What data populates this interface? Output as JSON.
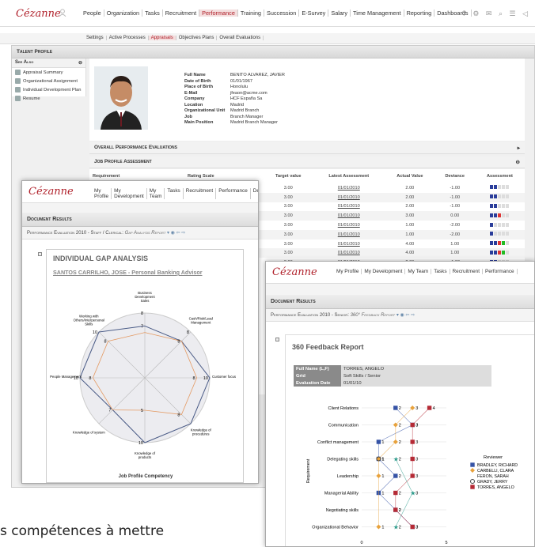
{
  "brand": "Cézanne",
  "main_nav": [
    "People",
    "Organization",
    "Tasks",
    "Recruitment",
    "Performance",
    "Training",
    "Succession",
    "E-Survey",
    "Salary",
    "Time Management",
    "Reporting",
    "Dashboards"
  ],
  "main_nav_active": "Performance",
  "sub_nav": [
    "Settings",
    "Active Processes",
    "Appraisals",
    "Objectives Plans",
    "Overall Evaluations"
  ],
  "sub_nav_active": "Appraisals",
  "talent_profile": "Talent Profile",
  "see_also": {
    "title": "See Also",
    "items": [
      "Appraisal Summary",
      "Organizational Assignment",
      "Individual Development Plan",
      "Resume"
    ]
  },
  "profile": [
    {
      "k": "Full Name",
      "v": "BENITO ALVAREZ, JAVIER"
    },
    {
      "k": "Date of Birth",
      "v": "01/01/1967"
    },
    {
      "k": "Place of Birth",
      "v": "Honolulu"
    },
    {
      "k": "E-Mail",
      "v": "jfeaon@acme.com"
    },
    {
      "k": "Company",
      "v": "HCF España Sa"
    },
    {
      "k": "Location",
      "v": "Madrid"
    },
    {
      "k": "Organizational Unit",
      "v": "Madrid Branch"
    },
    {
      "k": "Job",
      "v": "Branch Manager"
    },
    {
      "k": "Main Position",
      "v": "Madrid Branch Manager"
    }
  ],
  "overall_eval": "Overall Performance Evaluations",
  "job_profile": "Job Profile Assessment",
  "jp_headers": [
    "Requirement",
    "Rating Scale",
    "Target value",
    "Latest Assessment",
    "Actual Value",
    "Deviance",
    "Assessment"
  ],
  "jp_rows": [
    {
      "t": "3.00",
      "d": "01/01/2010",
      "a": "2.00",
      "dev": "-1.00"
    },
    {
      "t": "3.00",
      "d": "01/01/2010",
      "a": "2.00",
      "dev": "-1.00"
    },
    {
      "t": "3.00",
      "d": "01/01/2010",
      "a": "2.00",
      "dev": "-1.00"
    },
    {
      "t": "3.00",
      "d": "01/01/2010",
      "a": "3.00",
      "dev": "0.00"
    },
    {
      "t": "3.00",
      "d": "01/01/2010",
      "a": "1.00",
      "dev": "-2.00"
    },
    {
      "t": "3.00",
      "d": "01/01/2010",
      "a": "1.00",
      "dev": "-2.00"
    },
    {
      "t": "3.00",
      "d": "01/01/2010",
      "a": "4.00",
      "dev": "1.00"
    },
    {
      "t": "3.00",
      "d": "01/01/2010",
      "a": "4.00",
      "dev": "1.00"
    },
    {
      "t": "3.00",
      "d": "01/01/2010",
      "a": "2.00",
      "dev": "-1.00"
    }
  ],
  "gap_window": {
    "nav": [
      "My Profile",
      "My Development",
      "My Team",
      "Tasks",
      "Recruitment",
      "Performance",
      "Dev"
    ],
    "doc_results": "Document Results",
    "eval_title": "Performance Evaluation 2010 - Staff / Clerical:",
    "eval_sub": "Gap Analysis Report",
    "report_title": "INDIVIDUAL GAP ANALYSIS",
    "person": "SANTOS CARRILHO, JOSE - Personal Banking Advisor",
    "footer": "Job Profile Competency"
  },
  "fb_window": {
    "nav": [
      "My Profile",
      "My Development",
      "My Team",
      "Tasks",
      "Recruitment",
      "Performance"
    ],
    "doc_results": "Document Results",
    "eval_title": "Performance Evaluation 2010 - Senior:",
    "eval_sub": "360° Feedback Report",
    "report_title": "360 Feedback Report",
    "info": [
      {
        "k": "Full Name (L,F)",
        "v": "TORRES, ANGELO"
      },
      {
        "k": "Grid",
        "v": "Soft Skills / Senior"
      },
      {
        "k": "Evaluation Date",
        "v": "01/01/10"
      }
    ],
    "ylabel": "Requirement",
    "legend_title": "Reviewer"
  },
  "footer_text": "s compétences à mettre",
  "chart_data": [
    {
      "type": "radar",
      "categories": [
        "Business Development Sales",
        "Cash/Risk/Lead Management",
        "Customer focus",
        "Knowledge of procedures",
        "Knowledge of products",
        "Knowledge of system",
        "People Management",
        "Working with Others/Interpersonal Skills"
      ],
      "series": [
        {
          "values": [
            8,
            8,
            10,
            10,
            10,
            7,
            10,
            10
          ]
        },
        {
          "values": [
            7,
            8,
            8,
            8,
            5,
            7,
            8,
            8
          ]
        }
      ],
      "category_labels": [
        {
          "t": [
            "Business",
            "Development",
            "Sales"
          ]
        },
        {
          "t": [
            "Cash/Risk/Lead",
            "Management"
          ]
        },
        {
          "t": [
            "Customer focus"
          ]
        },
        {
          "t": [
            "Knowledge of",
            "procedures"
          ]
        },
        {
          "t": [
            "Knowledge of",
            "products"
          ]
        },
        {
          "t": [
            "Knowledge of system"
          ]
        },
        {
          "t": [
            "People Management"
          ]
        },
        {
          "t": [
            "Working with",
            "Others/Interpersonal",
            "Skills"
          ]
        }
      ],
      "value_labels": [
        {
          "i": 0,
          "r": 10,
          "v": "8"
        },
        {
          "i": 0,
          "r": 8,
          "v": "7"
        },
        {
          "i": 1,
          "r": 10,
          "v": "8"
        },
        {
          "i": 1,
          "r": 8,
          "v": "8"
        },
        {
          "i": 2,
          "r": 10,
          "v": "10"
        },
        {
          "i": 2,
          "r": 8,
          "v": "8"
        },
        {
          "i": 3,
          "r": 8,
          "v": "8"
        },
        {
          "i": 4,
          "r": 10,
          "v": "10"
        },
        {
          "i": 4,
          "r": 5,
          "v": "5"
        },
        {
          "i": 5,
          "r": 7,
          "v": "7"
        },
        {
          "i": 6,
          "r": 10,
          "v": "10"
        },
        {
          "i": 6,
          "r": 8,
          "v": "8"
        },
        {
          "i": 7,
          "r": 10,
          "v": "10"
        },
        {
          "i": 7,
          "r": 8,
          "v": "8"
        }
      ],
      "rmax": 10,
      "xlabel": "Job Profile Competency"
    },
    {
      "type": "scatter",
      "categories": [
        "Client Relations",
        "Communication",
        "Conflict management",
        "Delegating skills",
        "Leadership",
        "Managerial Ability",
        "Negotiating skills",
        "Organizational Behavior"
      ],
      "ylabel": "Requirement",
      "xlim": [
        0,
        5
      ],
      "xticks": [
        "0",
        "5"
      ],
      "series": [
        {
          "name": "BRADLEY, RICHARD",
          "color": "#3553a6",
          "marker": "square",
          "values": [
            2,
            3,
            1,
            1,
            2,
            1,
            2,
            3
          ]
        },
        {
          "name": "CARBELLI, CLARA",
          "color": "#e8a23c",
          "marker": "diamond",
          "values": [
            3,
            2,
            2,
            1,
            1,
            null,
            null,
            1
          ]
        },
        {
          "name": "FERON, SARAH",
          "color": "#2a9a8a",
          "marker": "star",
          "values": [
            null,
            null,
            null,
            2,
            null,
            3,
            null,
            2
          ]
        },
        {
          "name": "GRADY, JERRY",
          "color": "#444444",
          "marker": "circle",
          "values": [
            null,
            null,
            null,
            1,
            null,
            null,
            null,
            null
          ]
        },
        {
          "name": "TORRES, ANGELO",
          "color": "#b52a35",
          "marker": "square",
          "values": [
            4,
            3,
            3,
            3,
            3,
            2,
            2,
            3
          ]
        }
      ]
    }
  ]
}
